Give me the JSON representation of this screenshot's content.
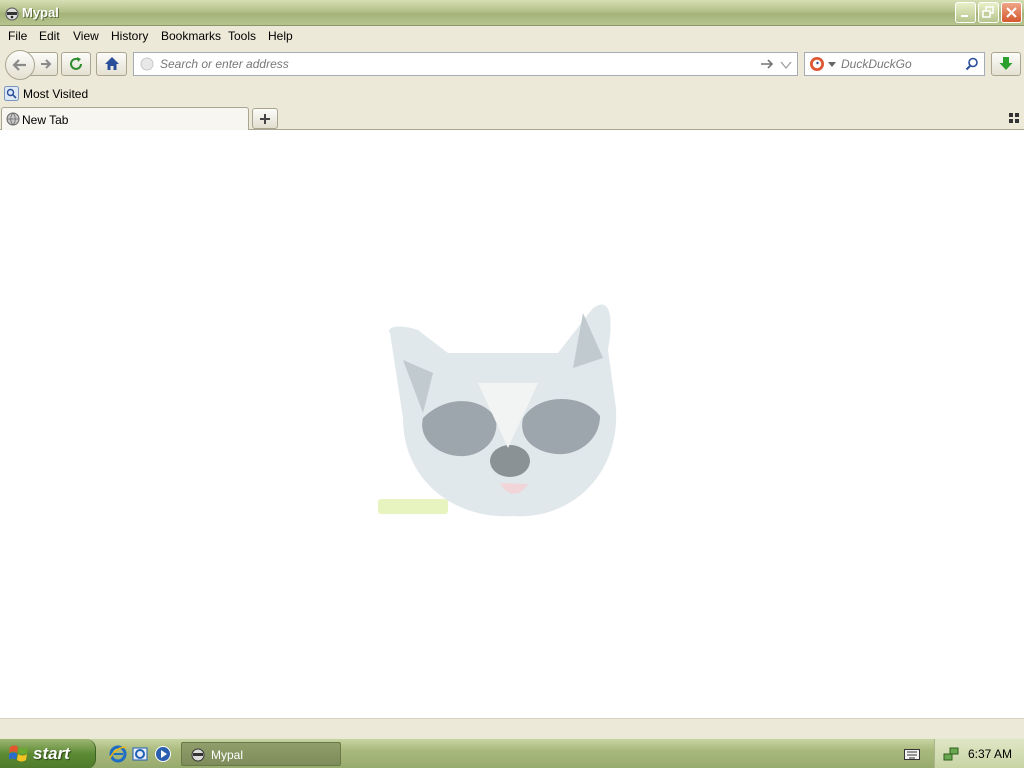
{
  "window": {
    "title": "Mypal"
  },
  "menu": {
    "items": [
      {
        "label": "File"
      },
      {
        "label": "Edit"
      },
      {
        "label": "View"
      },
      {
        "label": "History"
      },
      {
        "label": "Bookmarks"
      },
      {
        "label": "Tools"
      },
      {
        "label": "Help"
      }
    ]
  },
  "navbar": {
    "address_placeholder": "Search or enter address",
    "search_placeholder": "DuckDuckGo"
  },
  "bookmarks": {
    "items": [
      {
        "label": "Most Visited"
      }
    ]
  },
  "tabs": [
    {
      "label": "New Tab",
      "active": true
    }
  ],
  "content": {
    "watermark_icon": "raccoon-logo"
  },
  "taskbar": {
    "start_label": "start",
    "quick_launch": [
      "internet-explorer-icon",
      "outlook-express-icon",
      "media-player-icon"
    ],
    "tasks": [
      {
        "label": "Mypal"
      }
    ],
    "clock": "6:37 AM"
  },
  "colors": {
    "titlebar": "#b3c08a",
    "taskbar": "#a8b97c",
    "start": "#5c8a34",
    "chrome": "#ece9d8",
    "content": "#ffffff"
  }
}
